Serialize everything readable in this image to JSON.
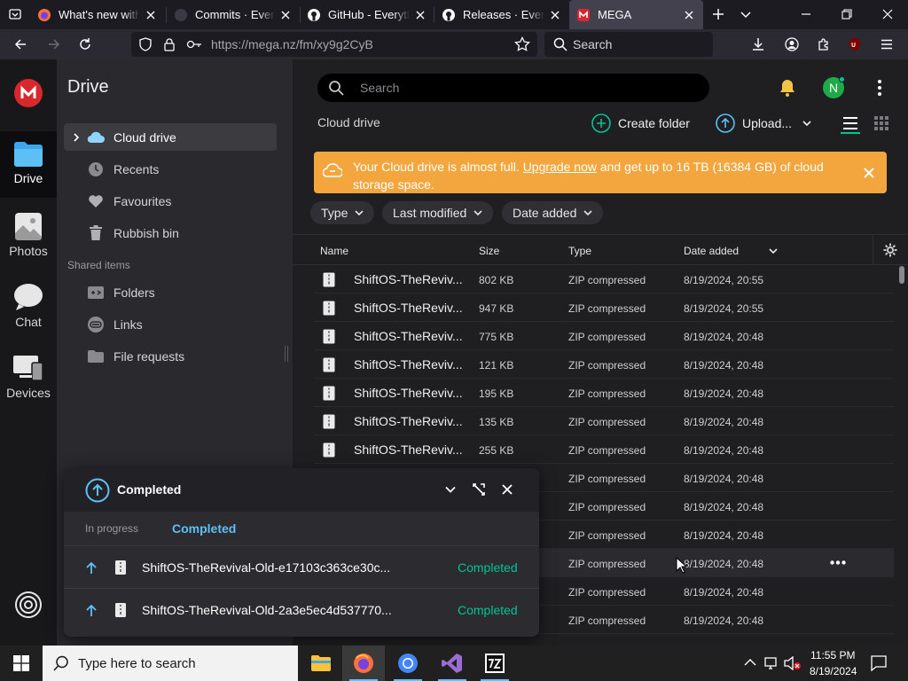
{
  "browser": {
    "tabs": [
      {
        "title": "What's new with Firefox"
      },
      {
        "title": "Commits · Everything"
      },
      {
        "title": "GitHub - Everything"
      },
      {
        "title": "Releases · Everything"
      },
      {
        "title": "MEGA"
      }
    ],
    "url_host": "https://mega.nz",
    "url_path": "/fm/xy9g2CyB",
    "search_placeholder": "Search"
  },
  "rail": {
    "items": [
      {
        "label": "Drive",
        "icon": "folder-icon"
      },
      {
        "label": "Photos",
        "icon": "photos-icon"
      },
      {
        "label": "Chat",
        "icon": "chat-icon"
      },
      {
        "label": "Devices",
        "icon": "devices-icon"
      }
    ]
  },
  "sidebar": {
    "title": "Drive",
    "items": [
      {
        "label": "Cloud drive"
      },
      {
        "label": "Recents"
      },
      {
        "label": "Favourites"
      },
      {
        "label": "Rubbish bin"
      }
    ],
    "shared_heading": "Shared items",
    "shared_items": [
      {
        "label": "Folders"
      },
      {
        "label": "Links"
      },
      {
        "label": "File requests"
      }
    ]
  },
  "main": {
    "search_placeholder": "Search",
    "avatar_letter": "N",
    "breadcrumb": "Cloud drive",
    "create_folder": "Create folder",
    "upload": "Upload...",
    "banner": {
      "text_before": "Your Cloud drive is almost full. ",
      "link": "Upgrade now",
      "text_after": " and get up to 16 TB (16384 GB) of cloud storage space."
    },
    "filters": [
      "Type",
      "Last modified",
      "Date added"
    ],
    "columns": {
      "name": "Name",
      "size": "Size",
      "type": "Type",
      "date": "Date added"
    },
    "rows": [
      {
        "name": "ShiftOS-TheReviv...",
        "size": "802 KB",
        "type": "ZIP compressed",
        "date": "8/19/2024, 20:55"
      },
      {
        "name": "ShiftOS-TheReviv...",
        "size": "947 KB",
        "type": "ZIP compressed",
        "date": "8/19/2024, 20:55"
      },
      {
        "name": "ShiftOS-TheReviv...",
        "size": "775 KB",
        "type": "ZIP compressed",
        "date": "8/19/2024, 20:48"
      },
      {
        "name": "ShiftOS-TheReviv...",
        "size": "121 KB",
        "type": "ZIP compressed",
        "date": "8/19/2024, 20:48"
      },
      {
        "name": "ShiftOS-TheReviv...",
        "size": "195 KB",
        "type": "ZIP compressed",
        "date": "8/19/2024, 20:48"
      },
      {
        "name": "ShiftOS-TheReviv...",
        "size": "135 KB",
        "type": "ZIP compressed",
        "date": "8/19/2024, 20:48"
      },
      {
        "name": "ShiftOS-TheReviv...",
        "size": "255 KB",
        "type": "ZIP compressed",
        "date": "8/19/2024, 20:48"
      },
      {
        "name": "",
        "size": "",
        "type": "ZIP compressed",
        "date": "8/19/2024, 20:48"
      },
      {
        "name": "",
        "size": "",
        "type": "ZIP compressed",
        "date": "8/19/2024, 20:48"
      },
      {
        "name": "",
        "size": "",
        "type": "ZIP compressed",
        "date": "8/19/2024, 20:48"
      },
      {
        "name": "",
        "size": "",
        "type": "ZIP compressed",
        "date": "8/19/2024, 20:48"
      },
      {
        "name": "",
        "size": "",
        "type": "ZIP compressed",
        "date": "8/19/2024, 20:48"
      },
      {
        "name": "",
        "size": "",
        "type": "ZIP compressed",
        "date": "8/19/2024, 20:48"
      }
    ]
  },
  "transfers": {
    "title": "Completed",
    "tab_in_progress": "In progress",
    "tab_completed": "Completed",
    "items": [
      {
        "name": "ShiftOS-TheRevival-Old-e17103c363ce30c...",
        "status": "Completed"
      },
      {
        "name": "ShiftOS-TheRevival-Old-2a3e5ec4d537770...",
        "status": "Completed"
      }
    ]
  },
  "taskbar": {
    "search_placeholder": "Type here to search",
    "time": "11:55 PM",
    "date": "8/19/2024"
  },
  "colors": {
    "banner": "#f3a63e",
    "accent": "#00c398",
    "completed": "#00c398",
    "brand": "#d9272e"
  }
}
